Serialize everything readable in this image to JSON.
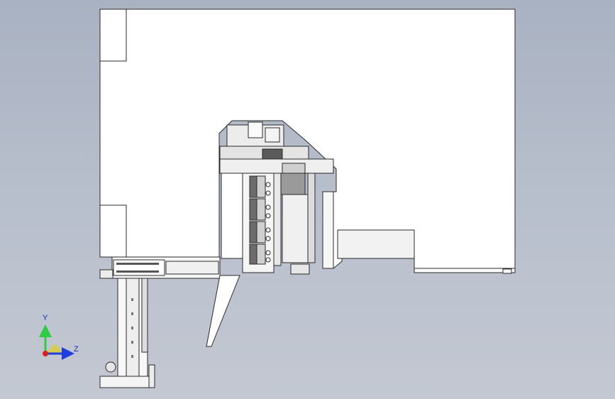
{
  "viewport": {
    "background_top": "#a9b2c2",
    "background_bottom": "#c3c8d2"
  },
  "triad": {
    "y_label": "Y",
    "z_label": "Z",
    "y_color": "#2ecc40",
    "z_color": "#1e3fe0",
    "x_color": "#e02020"
  },
  "colors": {
    "line": "#2a2a2a",
    "face": "#ffffff",
    "shade": "#d9d9d9",
    "dark": "#8a8a8a"
  }
}
